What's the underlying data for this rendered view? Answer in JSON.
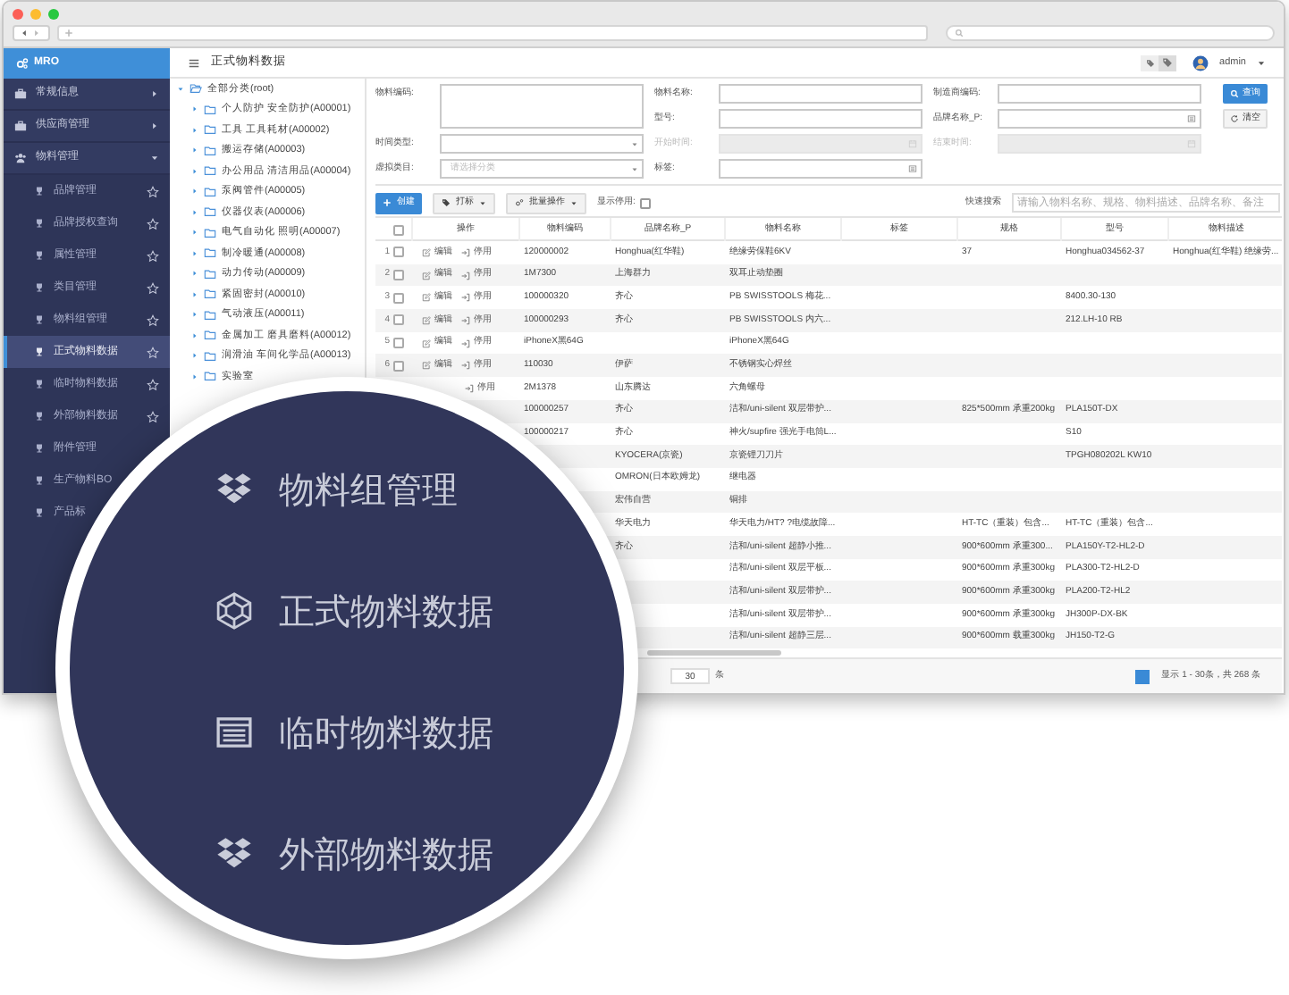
{
  "app": {
    "logo": "MRO",
    "page_title": "正式物料数据",
    "user": "admin"
  },
  "sidebar": [
    {
      "label": "常规信息",
      "kind": "briefcase",
      "expanded": false
    },
    {
      "label": "供应商管理",
      "kind": "briefcase",
      "expanded": false
    },
    {
      "label": "物料管理",
      "kind": "users",
      "expanded": true,
      "children": [
        {
          "label": "品牌管理",
          "selected": false,
          "pinned": true
        },
        {
          "label": "品牌授权查询",
          "selected": false,
          "pinned": true
        },
        {
          "label": "属性管理",
          "selected": false,
          "pinned": true
        },
        {
          "label": "类目管理",
          "selected": false,
          "pinned": true
        },
        {
          "label": "物料组管理",
          "selected": false,
          "pinned": true
        },
        {
          "label": "正式物料数据",
          "selected": true,
          "pinned": true
        },
        {
          "label": "临时物料数据",
          "selected": false,
          "pinned": true
        },
        {
          "label": "外部物料数据",
          "selected": false,
          "pinned": true
        },
        {
          "label": "附件管理",
          "selected": false,
          "pinned": false
        },
        {
          "label": "生产物料BO",
          "selected": false,
          "pinned": false
        },
        {
          "label": "产品标",
          "selected": false,
          "pinned": false
        }
      ]
    }
  ],
  "tree": {
    "label": "全部分类(root)",
    "expanded": true,
    "children": [
      {
        "label": "个人防护 安全防护(A00001)",
        "expanded": false
      },
      {
        "label": "工具 工具耗材(A00002)",
        "expanded": false
      },
      {
        "label": "搬运存储(A00003)",
        "expanded": false
      },
      {
        "label": "办公用品 清洁用品(A00004)",
        "expanded": false
      },
      {
        "label": "泵阀管件(A00005)",
        "expanded": false
      },
      {
        "label": "仪器仪表(A00006)",
        "expanded": false
      },
      {
        "label": "电气自动化 照明(A00007)",
        "expanded": false
      },
      {
        "label": "制冷暖通(A00008)",
        "expanded": false
      },
      {
        "label": "动力传动(A00009)",
        "expanded": false
      },
      {
        "label": "紧固密封(A00010)",
        "expanded": false
      },
      {
        "label": "气动液压(A00011)",
        "expanded": false
      },
      {
        "label": "金属加工 磨具磨料(A00012)",
        "expanded": false
      },
      {
        "label": "润滑油 车间化学品(A00013)",
        "expanded": false
      },
      {
        "label": "实验室",
        "expanded": false
      }
    ]
  },
  "filters": [
    {
      "label": "物料编码:",
      "kind": "textarea",
      "disabled": false
    },
    {
      "label": "物料名称:",
      "kind": "text",
      "disabled": false
    },
    {
      "label": "制造商编码:",
      "kind": "text",
      "disabled": false
    },
    {
      "label": "型号:",
      "kind": "text",
      "disabled": false
    },
    {
      "label": "品牌名称_P:",
      "kind": "picker",
      "disabled": false
    },
    {
      "label": "时间类型:",
      "kind": "select",
      "disabled": false
    },
    {
      "label": "开始时间:",
      "kind": "date",
      "disabled": true
    },
    {
      "label": "结束时间:",
      "kind": "date",
      "disabled": true
    },
    {
      "label": "虚拟类目:",
      "kind": "select",
      "disabled": false,
      "placeholder": "请选择分类"
    },
    {
      "label": "标签:",
      "kind": "picker",
      "disabled": false
    }
  ],
  "filter_buttons": [
    {
      "label": "查询",
      "kind": "search"
    },
    {
      "label": "清空",
      "kind": "reset"
    }
  ],
  "toolbar": {
    "buttons": [
      {
        "label": "创建",
        "kind": "create"
      },
      {
        "label": "打标",
        "kind": "tag"
      },
      {
        "label": "批量操作",
        "kind": "batch"
      }
    ],
    "show_disabled": {
      "label": "显示停用:",
      "checked": false
    },
    "quick_search": {
      "label": "快速搜索",
      "placeholder": "请输入物料名称、规格、物料描述、品牌名称、备注"
    }
  },
  "table": {
    "select_all": false,
    "action_column": "操作",
    "columns": [
      "物料编码",
      "品牌名称_P",
      "物料名称",
      "标签",
      "规格",
      "型号",
      "物料描述"
    ],
    "rows": [
      {
        "no": "1",
        "checked": false,
        "actions": [
          {
            "kind": "edit",
            "label": "编辑"
          },
          {
            "kind": "disable",
            "label": "停用"
          }
        ],
        "cells": [
          "120000002",
          "Honghua(红华鞋)",
          "绝缘劳保鞋6KV",
          null,
          "37",
          "Honghua034562-37",
          "Honghua(红华鞋) 绝缘劳..."
        ]
      },
      {
        "no": "2",
        "checked": false,
        "actions": [
          {
            "kind": "edit",
            "label": "编辑"
          },
          {
            "kind": "disable",
            "label": "停用"
          }
        ],
        "cells": [
          "1M7300",
          "上海群力",
          "双耳止动垫圈",
          null,
          null,
          null,
          null
        ]
      },
      {
        "no": "3",
        "checked": false,
        "actions": [
          {
            "kind": "edit",
            "label": "编辑"
          },
          {
            "kind": "disable",
            "label": "停用"
          }
        ],
        "cells": [
          "100000320",
          "齐心",
          "PB SWISSTOOLS 梅花...",
          null,
          null,
          "8400.30-130",
          null
        ]
      },
      {
        "no": "4",
        "checked": false,
        "actions": [
          {
            "kind": "edit",
            "label": "编辑"
          },
          {
            "kind": "disable",
            "label": "停用"
          }
        ],
        "cells": [
          "100000293",
          "齐心",
          "PB SWISSTOOLS 内六...",
          null,
          null,
          "212.LH-10 RB",
          null
        ]
      },
      {
        "no": "5",
        "checked": false,
        "actions": [
          {
            "kind": "edit",
            "label": "编辑"
          },
          {
            "kind": "disable",
            "label": "停用"
          }
        ],
        "cells": [
          "iPhoneX黑64G",
          null,
          "iPhoneX黑64G",
          null,
          null,
          null,
          null
        ]
      },
      {
        "no": "6",
        "checked": false,
        "actions": [
          {
            "kind": "edit",
            "label": "编辑"
          },
          {
            "kind": "disable",
            "label": "停用"
          }
        ],
        "cells": [
          "110030",
          "伊萨",
          "不锈钢实心焊丝",
          null,
          null,
          null,
          null
        ]
      },
      {
        "actions": [
          {
            "kind": "disable",
            "label": "停用"
          }
        ],
        "cells": [
          "2M1378",
          "山东腾达",
          "六角螺母",
          null,
          null,
          null,
          null
        ]
      },
      {
        "cells": [
          "100000257",
          "齐心",
          "洁和/uni-silent 双层带护...",
          null,
          "825*500mm 承重200kg",
          "PLA150T-DX",
          null
        ]
      },
      {
        "cells": [
          "100000217",
          "齐心",
          "神火/supfire 强光手电筒L...",
          null,
          null,
          "S10",
          null
        ]
      },
      {
        "cells": [
          null,
          "KYOCERA(京瓷)",
          "京瓷锂刀刀片",
          null,
          null,
          "TPGH080202L KW10",
          null
        ]
      },
      {
        "cells": [
          null,
          "OMRON(日本欧姆龙)",
          "继电器",
          null,
          null,
          null,
          null
        ]
      },
      {
        "cells": [
          null,
          "宏伟自营",
          "铜排",
          null,
          null,
          null,
          null
        ]
      },
      {
        "cells": [
          null,
          "华天电力",
          "华天电力/HT? ?电缆故障...",
          null,
          "HT-TC（重装）包含...",
          "HT-TC（重装）包含...",
          null
        ]
      },
      {
        "cells": [
          null,
          "齐心",
          "洁和/uni-silent 超静小推...",
          null,
          "900*600mm 承重300...",
          "PLA150Y-T2-HL2-D",
          null
        ]
      },
      {
        "cells": [
          null,
          null,
          "洁和/uni-silent 双层平板...",
          null,
          "900*600mm 承重300kg",
          "PLA300-T2-HL2-D",
          null
        ]
      },
      {
        "cells": [
          null,
          null,
          "洁和/uni-silent 双层带护...",
          null,
          "900*600mm 承重300kg",
          "PLA200-T2-HL2",
          null
        ]
      },
      {
        "cells": [
          null,
          null,
          "洁和/uni-silent 双层带护...",
          null,
          "900*600mm 承重300kg",
          "JH300P-DX-BK",
          null
        ]
      },
      {
        "cells": [
          null,
          null,
          "洁和/uni-silent 超静三层...",
          null,
          "900*600mm 载重300kg",
          "JH150-T2-G",
          null
        ]
      }
    ]
  },
  "pagination": {
    "page_size": "30",
    "unit": "条",
    "summary": "显示 1 - 30条，共 268 条"
  },
  "magnifier": {
    "items": [
      {
        "label": "物料组管理",
        "kind": "boxes"
      },
      {
        "label": "正式物料数据",
        "kind": "cube"
      },
      {
        "label": "临时物料数据",
        "kind": "list"
      },
      {
        "label": "外部物料数据",
        "kind": "boxes"
      }
    ]
  }
}
